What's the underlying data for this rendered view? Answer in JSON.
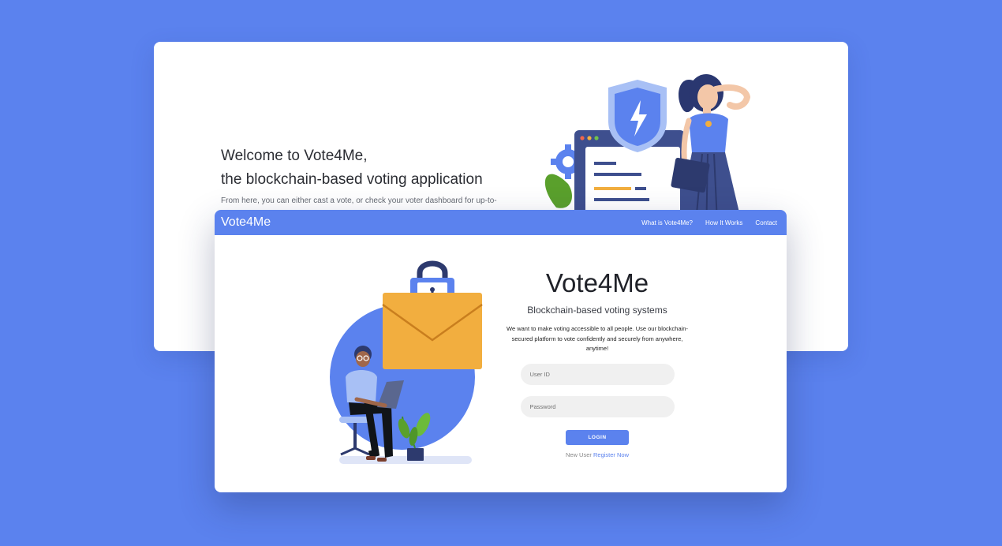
{
  "background_color": "#5b82ee",
  "back_page": {
    "title_line1": "Welcome to Vote4Me,",
    "title_line2": "the blockchain-based voting application",
    "description": "From here, you can either cast a vote, or check your voter dashboard for up-to-"
  },
  "front_page": {
    "navbar": {
      "brand": "Vote4Me",
      "links": [
        "What is Vote4Me?",
        "How It Works",
        "Contact"
      ]
    },
    "hero": {
      "title": "Vote4Me",
      "subtitle": "Blockchain-based voting systems",
      "description": "We want to make voting accessible to all people. Use our blockchain-secured platform to vote confidently and securely from anywhere, anytime!"
    },
    "form": {
      "user_id_placeholder": "User ID",
      "password_placeholder": "Password",
      "login_label": "LOGIN",
      "new_user_text": "New User",
      "register_link": "Register Now"
    }
  },
  "colors": {
    "accent": "#5b82ee",
    "envelope": "#f2ae3f",
    "navy": "#2d3a6e"
  },
  "icons": [
    "shield-bolt-icon",
    "padlock-icon",
    "envelope-icon",
    "gear-icon"
  ]
}
